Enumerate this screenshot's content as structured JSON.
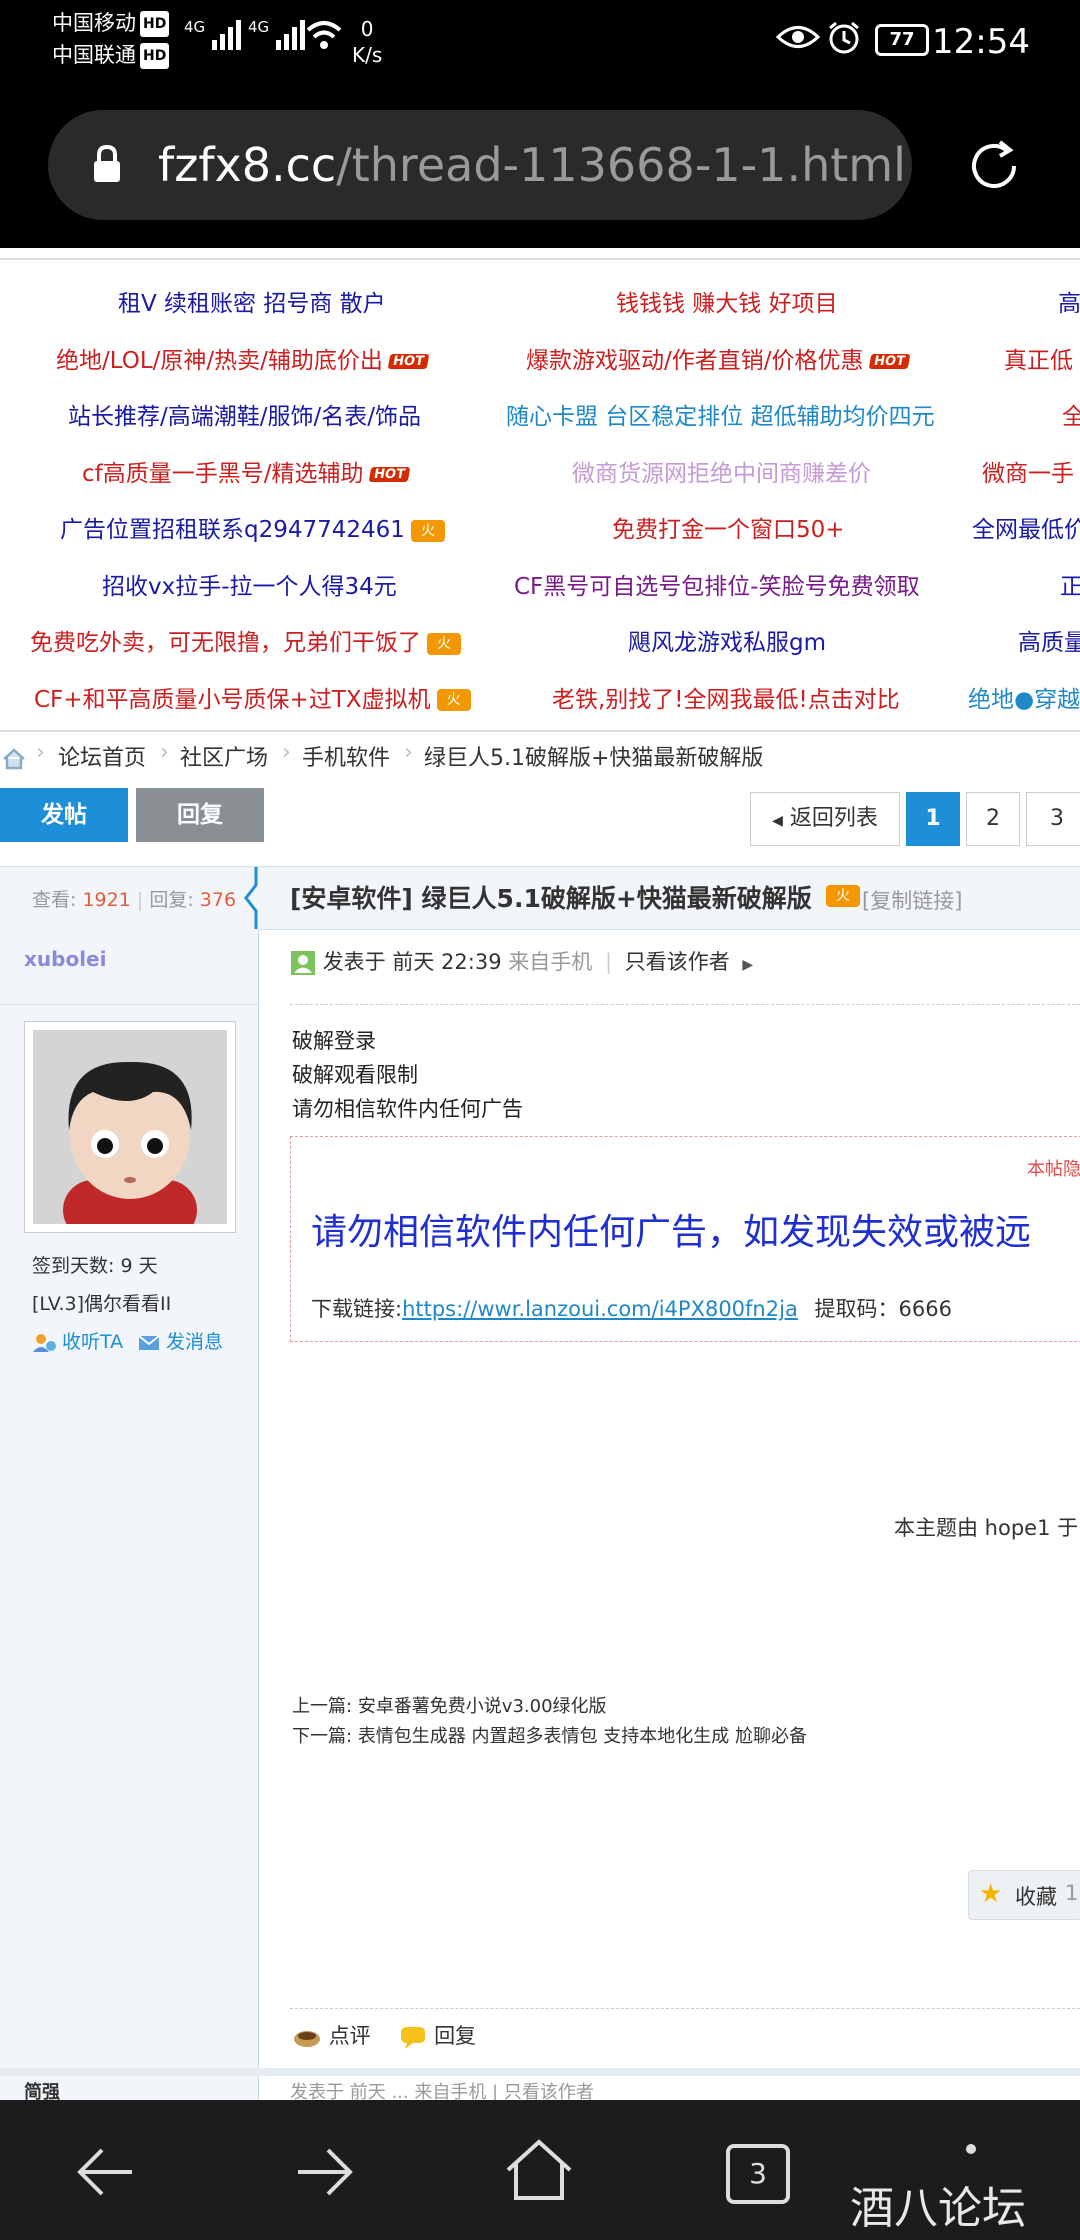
{
  "status": {
    "carrier1": "中国移动",
    "carrier2": "中国联通",
    "hd": "HD",
    "net1": "4G",
    "net2": "4G",
    "speed_value": "0",
    "speed_unit": "K/s",
    "battery": "77",
    "time": "12:54"
  },
  "browser": {
    "url_host": "fzfx8.cc",
    "url_path": "/thread-113668-1-1.html"
  },
  "ads": [
    {
      "text": "租V 续租账密 招号商 散户",
      "color": "#1a1aa6"
    },
    {
      "text": "钱钱钱 赚大钱 好项目",
      "color": "#cc1f1f"
    },
    {
      "text": "高",
      "color": "#1a1aa6"
    },
    {
      "text": "绝地/LOL/原神/热卖/辅助底价出",
      "color": "#cc1f1f"
    },
    {
      "text": "爆款游戏驱动/作者直销/价格优惠",
      "color": "#cc1f1f"
    },
    {
      "text": "真正低",
      "color": "#cc1f1f"
    },
    {
      "text": "站长推荐/高端潮鞋/服饰/名表/饰品",
      "color": "#1a1aa6"
    },
    {
      "text": "随心卡盟 台区稳定排位 超低辅助均价四元",
      "color": "#1e88c8"
    },
    {
      "text": "全",
      "color": "#cc1f1f"
    },
    {
      "text": "cf高质量一手黑号/精选辅助",
      "color": "#cc1f1f"
    },
    {
      "text": "微商货源网拒绝中间商赚差价",
      "color": "#c59ad6"
    },
    {
      "text": "微商一手",
      "color": "#cc1f1f"
    },
    {
      "text": "广告位置招租联系q2947742461",
      "color": "#1a1aa6"
    },
    {
      "text": "免费打金一个窗口50+",
      "color": "#cc1f1f"
    },
    {
      "text": "全网最低价",
      "color": "#1a1aa6"
    },
    {
      "text": "招收vx拉手-拉一个人得34元",
      "color": "#1a1aa6"
    },
    {
      "text": "CF黑号可自选号包排位-笑脸号免费领取",
      "color": "#7a1a8a"
    },
    {
      "text": "正",
      "color": "#1a1aa6"
    },
    {
      "text": "免费吃外卖，可无限撸，兄弟们干饭了",
      "color": "#cc1f1f"
    },
    {
      "text": "飓风龙游戏私服gm",
      "color": "#1a1aa6"
    },
    {
      "text": "高质量",
      "color": "#1a1aa6"
    },
    {
      "text": "CF+和平高质量小号质保+过TX虚拟机",
      "color": "#cc1f1f"
    },
    {
      "text": "老铁,别找了!全网我最低!点击对比",
      "color": "#cc1f1f"
    },
    {
      "text": "绝地●穿越",
      "color": "#1e88c8"
    }
  ],
  "hot_badge": "HOT",
  "new_badge": "火",
  "breadcrumb": [
    "论坛首页",
    "社区广场",
    "手机软件",
    "绿巨人5.1破解版+快猫最新破解版"
  ],
  "actions": {
    "post": "发帖",
    "reply": "回复",
    "back_list": "返回列表",
    "pages": [
      "1",
      "2",
      "3"
    ]
  },
  "stats": {
    "views_label": "查看:",
    "views": "1921",
    "replies_label": "回复:",
    "replies": "376"
  },
  "thread": {
    "title": "[安卓软件] 绿巨人5.1破解版+快猫最新破解版",
    "copy_link": "[复制链接]"
  },
  "author": {
    "name": "xubolei",
    "signin": "签到天数: 9 天",
    "level": "[LV.3]偶尔看看II",
    "follow": "收听TA",
    "message": "发消息"
  },
  "post": {
    "posted_at": "发表于 前天 22:39",
    "from_phone": "来自手机",
    "only_author": "只看该作者",
    "lines": [
      "破解登录",
      "破解观看限制",
      "请勿相信软件内任何广告"
    ],
    "hidden_note": "本帖隐",
    "warning": "请勿相信软件内任何广告，如发现失效或被远",
    "download_label": "下载链接:",
    "download_link": "https://wwr.lanzoui.com/i4PX800fn2ja",
    "code_label": "提取码：6666",
    "edited_by": "本主题由 hope1 于",
    "prev_label": "上一篇:",
    "prev": "安卓番薯免费小说v3.00绿化版",
    "next_label": "下一篇:",
    "next": "表情包生成器 内置超多表情包 支持本地化生成 尬聊必备",
    "favorite": "收藏",
    "favorite_count": "1",
    "rate": "点评",
    "reply": "回复"
  },
  "bottom_partial": {
    "name": "简强",
    "meta": "发表于 前天 ... 来自手机 | 只看该作者"
  },
  "nav": {
    "tabs": "3",
    "watermark": "酒八论坛"
  }
}
